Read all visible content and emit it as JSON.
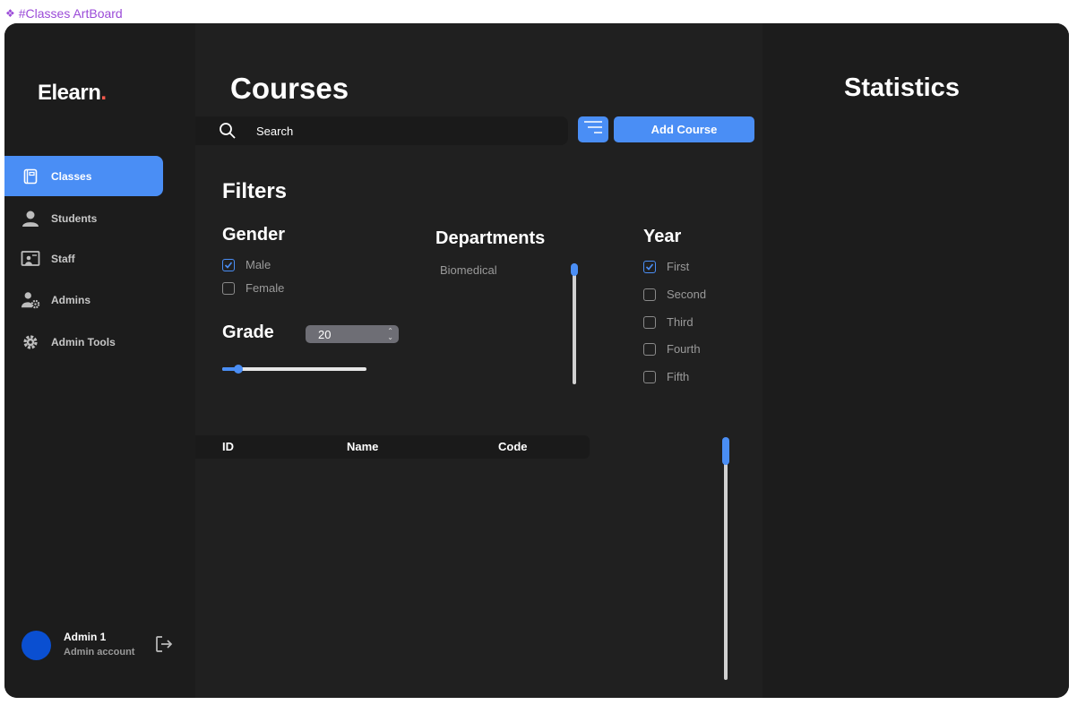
{
  "artboard": {
    "label": "#Classes ArtBoard"
  },
  "sidebar": {
    "logo_text": "Elearn",
    "logo_dot": ".",
    "items": [
      {
        "label": "Classes",
        "icon": "book-icon",
        "active": true
      },
      {
        "label": "Students",
        "icon": "person-icon",
        "active": false
      },
      {
        "label": "Staff",
        "icon": "presentation-icon",
        "active": false
      },
      {
        "label": "Admins",
        "icon": "user-gear-icon",
        "active": false
      },
      {
        "label": "Admin Tools",
        "icon": "gear-icon",
        "active": false
      }
    ],
    "profile": {
      "name": "Admin 1",
      "role": "Admin account"
    }
  },
  "main": {
    "title": "Courses",
    "search": {
      "placeholder": "Search",
      "value": ""
    },
    "add_button": "Add Course",
    "filters": {
      "title": "Filters",
      "gender": {
        "title": "Gender",
        "options": [
          {
            "label": "Male",
            "checked": true
          },
          {
            "label": "Female",
            "checked": false
          }
        ]
      },
      "grade": {
        "title": "Grade",
        "selected": "20",
        "slider_fraction": 0.08
      },
      "departments": {
        "title": "Departments",
        "items": [
          "Biomedical"
        ]
      },
      "year": {
        "title": "Year",
        "options": [
          {
            "label": "First",
            "checked": true
          },
          {
            "label": "Second",
            "checked": false
          },
          {
            "label": "Third",
            "checked": false
          },
          {
            "label": "Fourth",
            "checked": false
          },
          {
            "label": "Fifth",
            "checked": false
          }
        ]
      }
    },
    "table": {
      "columns": [
        "ID",
        "Name",
        "Code"
      ],
      "rows": []
    }
  },
  "stats": {
    "title": "Statistics"
  },
  "colors": {
    "accent": "#4a8ef5",
    "brand_dot": "#ff5a4e",
    "avatar": "#0a4fd1",
    "background": "#1c1c1c"
  }
}
